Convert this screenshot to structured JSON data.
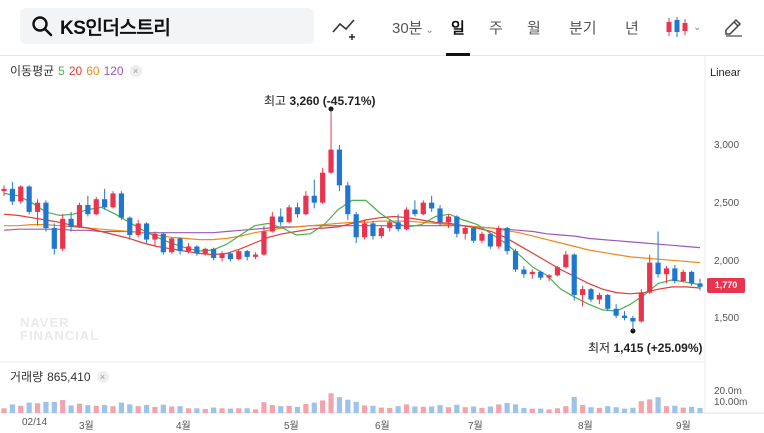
{
  "search": {
    "stock_name": "KS인더스트리"
  },
  "toolbar": {
    "interval_label": "30분",
    "periods": [
      "일",
      "주",
      "월",
      "분기",
      "년"
    ],
    "active_period": "일"
  },
  "moving_average": {
    "label": "이동평균",
    "periods": [
      "5",
      "20",
      "60",
      "120"
    ],
    "colors": [
      "#4caf50",
      "#e53935",
      "#ef8a17",
      "#9b59b6"
    ]
  },
  "scale_mode": "Linear",
  "annotations": {
    "high_label": "최고",
    "high_value": "3,260 (-45.71%)",
    "low_label": "최저",
    "low_value": "1,415 (+25.09%)"
  },
  "current_price": "1,770",
  "volume": {
    "label": "거래량",
    "value": "865,410",
    "ticks": [
      "20.0m",
      "10.00m"
    ]
  },
  "watermark": [
    "NAVER",
    "FINANCIAL"
  ],
  "colors": {
    "up": "#e8344e",
    "down": "#1f77d0",
    "accent_blue": "#1f77d0"
  },
  "chart_data": {
    "type": "candlestick",
    "y_ticks": [
      "3,000",
      "2,500",
      "2,000",
      "1,500"
    ],
    "ylim": [
      1300,
      3400
    ],
    "x_ticks": [
      "02/14",
      "3월",
      "4월",
      "5월",
      "6월",
      "7월",
      "8월",
      "9월"
    ],
    "high": 3260,
    "low": 1415,
    "last": 1770,
    "candles": [
      [
        2600,
        2650,
        2560,
        2620
      ],
      [
        2620,
        2680,
        2480,
        2510
      ],
      [
        2510,
        2650,
        2490,
        2640
      ],
      [
        2640,
        2650,
        2400,
        2420
      ],
      [
        2420,
        2530,
        2300,
        2500
      ],
      [
        2500,
        2520,
        2250,
        2280
      ],
      [
        2280,
        2320,
        2050,
        2100
      ],
      [
        2100,
        2400,
        2080,
        2360
      ],
      [
        2360,
        2420,
        2250,
        2290
      ],
      [
        2290,
        2500,
        2280,
        2480
      ],
      [
        2480,
        2560,
        2380,
        2400
      ],
      [
        2400,
        2550,
        2390,
        2530
      ],
      [
        2530,
        2620,
        2440,
        2460
      ],
      [
        2460,
        2600,
        2450,
        2580
      ],
      [
        2580,
        2600,
        2350,
        2370
      ],
      [
        2370,
        2380,
        2180,
        2220
      ],
      [
        2220,
        2350,
        2200,
        2320
      ],
      [
        2320,
        2330,
        2150,
        2180
      ],
      [
        2180,
        2250,
        2120,
        2230
      ],
      [
        2230,
        2240,
        2050,
        2070
      ],
      [
        2070,
        2200,
        2060,
        2190
      ],
      [
        2190,
        2200,
        2050,
        2080
      ],
      [
        2080,
        2150,
        2060,
        2120
      ],
      [
        2120,
        2130,
        2040,
        2060
      ],
      [
        2060,
        2110,
        2040,
        2100
      ],
      [
        2100,
        2110,
        2000,
        2020
      ],
      [
        2020,
        2080,
        1990,
        2060
      ],
      [
        2060,
        2070,
        1990,
        2010
      ],
      [
        2010,
        2090,
        2000,
        2080
      ],
      [
        2080,
        2090,
        2000,
        2030
      ],
      [
        2030,
        2070,
        2010,
        2050
      ],
      [
        2050,
        2300,
        2040,
        2250
      ],
      [
        2250,
        2420,
        2240,
        2380
      ],
      [
        2380,
        2450,
        2300,
        2330
      ],
      [
        2330,
        2480,
        2320,
        2460
      ],
      [
        2460,
        2500,
        2370,
        2400
      ],
      [
        2400,
        2600,
        2390,
        2560
      ],
      [
        2560,
        2700,
        2450,
        2500
      ],
      [
        2500,
        2800,
        2490,
        2760
      ],
      [
        2760,
        3260,
        2750,
        2960
      ],
      [
        2960,
        3000,
        2600,
        2650
      ],
      [
        2650,
        2680,
        2350,
        2400
      ],
      [
        2400,
        2420,
        2150,
        2200
      ],
      [
        2200,
        2350,
        2180,
        2320
      ],
      [
        2320,
        2340,
        2180,
        2210
      ],
      [
        2210,
        2300,
        2190,
        2280
      ],
      [
        2280,
        2350,
        2250,
        2330
      ],
      [
        2330,
        2400,
        2250,
        2270
      ],
      [
        2270,
        2460,
        2260,
        2440
      ],
      [
        2440,
        2520,
        2380,
        2400
      ],
      [
        2400,
        2520,
        2390,
        2500
      ],
      [
        2500,
        2560,
        2420,
        2450
      ],
      [
        2450,
        2480,
        2300,
        2330
      ],
      [
        2330,
        2400,
        2280,
        2380
      ],
      [
        2380,
        2390,
        2200,
        2230
      ],
      [
        2230,
        2300,
        2180,
        2280
      ],
      [
        2280,
        2290,
        2150,
        2170
      ],
      [
        2170,
        2250,
        2150,
        2230
      ],
      [
        2230,
        2240,
        2100,
        2120
      ],
      [
        2120,
        2300,
        2100,
        2280
      ],
      [
        2280,
        2290,
        2050,
        2080
      ],
      [
        2080,
        2100,
        1900,
        1920
      ],
      [
        1920,
        1950,
        1850,
        1880
      ],
      [
        1880,
        1920,
        1840,
        1900
      ],
      [
        1900,
        1910,
        1830,
        1850
      ],
      [
        1850,
        1880,
        1820,
        1870
      ],
      [
        1870,
        1950,
        1860,
        1940
      ],
      [
        1940,
        2080,
        1930,
        2050
      ],
      [
        2050,
        2060,
        1650,
        1700
      ],
      [
        1700,
        1780,
        1600,
        1750
      ],
      [
        1750,
        1760,
        1640,
        1660
      ],
      [
        1660,
        1720,
        1620,
        1700
      ],
      [
        1700,
        1710,
        1560,
        1580
      ],
      [
        1580,
        1620,
        1500,
        1520
      ],
      [
        1520,
        1560,
        1480,
        1500
      ],
      [
        1500,
        1520,
        1415,
        1470
      ],
      [
        1470,
        1750,
        1460,
        1720
      ],
      [
        1720,
        2050,
        1710,
        1980
      ],
      [
        1980,
        2250,
        1850,
        1880
      ],
      [
        1880,
        1950,
        1800,
        1930
      ],
      [
        1930,
        1960,
        1800,
        1820
      ],
      [
        1820,
        1920,
        1810,
        1900
      ],
      [
        1900,
        1910,
        1780,
        1800
      ],
      [
        1800,
        1840,
        1740,
        1770
      ]
    ],
    "ma5": [
      2580,
      2560,
      2500,
      2420,
      2390,
      2400,
      2440,
      2460,
      2400,
      2330,
      2260,
      2200,
      2150,
      2110,
      2080,
      2090,
      2140,
      2220,
      2300,
      2320,
      2280,
      2220,
      2230,
      2310,
      2440,
      2520,
      2520,
      2410,
      2330,
      2290,
      2310,
      2380,
      2400,
      2350,
      2310,
      2230,
      2150,
      2050,
      1940,
      1870,
      1750,
      1680,
      1620,
      1570,
      1560,
      1620,
      1700,
      1800,
      1830,
      1810,
      1790
    ],
    "ma20": [
      2400,
      2390,
      2370,
      2350,
      2330,
      2300,
      2280,
      2250,
      2220,
      2190,
      2150,
      2120,
      2100,
      2080,
      2060,
      2050,
      2060,
      2100,
      2150,
      2200,
      2230,
      2250,
      2270,
      2280,
      2290,
      2320,
      2350,
      2370,
      2380,
      2370,
      2350,
      2330,
      2320,
      2300,
      2280,
      2250,
      2200,
      2130,
      2060,
      1990,
      1920,
      1860,
      1800,
      1750,
      1720,
      1710,
      1720,
      1750,
      1770,
      1770,
      1760
    ],
    "ma60": [
      2300,
      2300,
      2310,
      2310,
      2300,
      2290,
      2280,
      2270,
      2260,
      2250,
      2240,
      2220,
      2200,
      2190,
      2180,
      2180,
      2190,
      2210,
      2240,
      2260,
      2280,
      2290,
      2300,
      2310,
      2320,
      2330,
      2330,
      2340,
      2340,
      2340,
      2330,
      2320,
      2310,
      2300,
      2290,
      2280,
      2260,
      2240,
      2210,
      2180,
      2150,
      2120,
      2090,
      2070,
      2050,
      2030,
      2020,
      2010,
      2000,
      1990,
      1980
    ],
    "ma120": [
      2260,
      2270,
      2270,
      2270,
      2270,
      2260,
      2260,
      2250,
      2250,
      2250,
      2240,
      2240,
      2240,
      2240,
      2240,
      2240,
      2250,
      2260,
      2270,
      2280,
      2290,
      2290,
      2300,
      2300,
      2300,
      2300,
      2300,
      2300,
      2300,
      2300,
      2300,
      2300,
      2300,
      2300,
      2290,
      2280,
      2270,
      2260,
      2250,
      2230,
      2220,
      2210,
      2190,
      2180,
      2170,
      2160,
      2150,
      2140,
      2130,
      2120,
      2110
    ]
  }
}
